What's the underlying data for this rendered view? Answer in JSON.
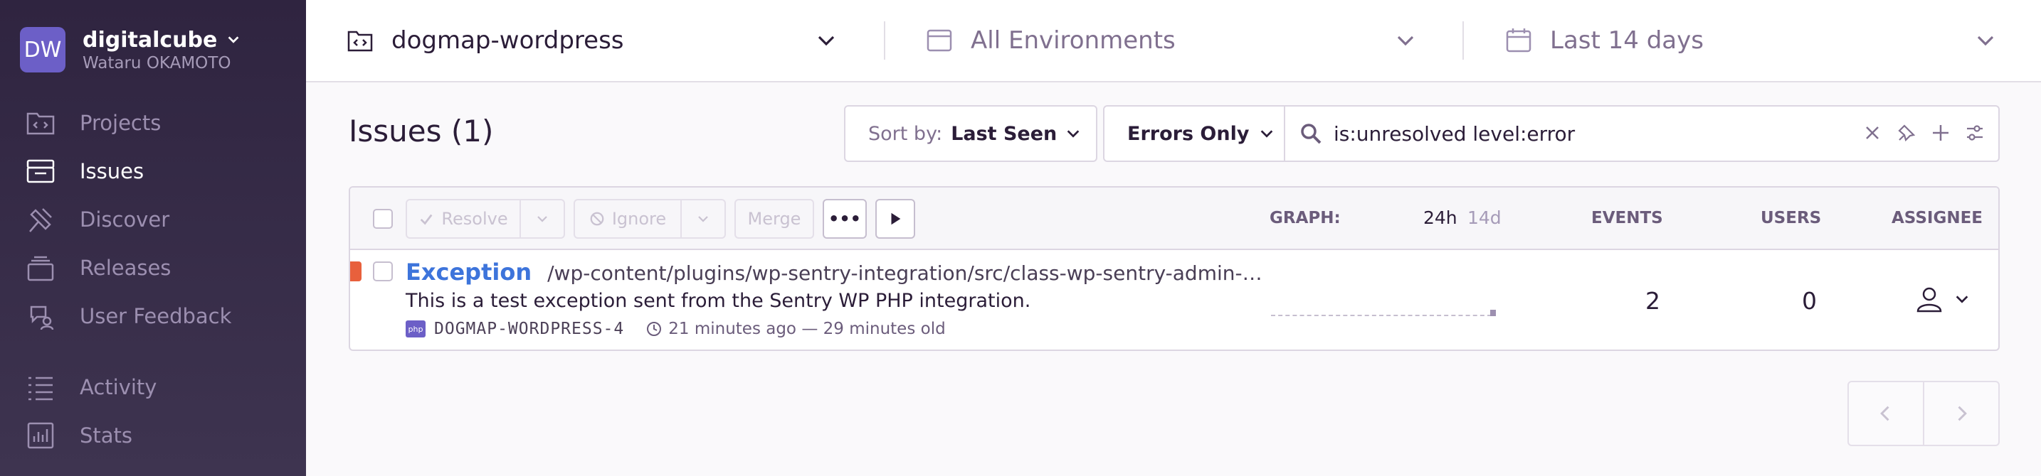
{
  "org": {
    "initials": "DW",
    "name": "digitalcube",
    "user": "Wataru OKAMOTO"
  },
  "sidebar": {
    "items": [
      {
        "label": "Projects",
        "icon": "projects-icon",
        "active": false
      },
      {
        "label": "Issues",
        "icon": "issues-icon",
        "active": true
      },
      {
        "label": "Discover",
        "icon": "discover-icon",
        "active": false
      },
      {
        "label": "Releases",
        "icon": "releases-icon",
        "active": false
      },
      {
        "label": "User Feedback",
        "icon": "user-feedback-icon",
        "active": false
      },
      {
        "label": "Activity",
        "icon": "activity-icon",
        "active": false
      },
      {
        "label": "Stats",
        "icon": "stats-icon",
        "active": false
      }
    ]
  },
  "header": {
    "project": "dogmap-wordpress",
    "environment": "All Environments",
    "period": "Last 14 days"
  },
  "issues": {
    "title": "Issues (1)",
    "sort_label": "Sort by:",
    "sort_value": "Last Seen",
    "filter": "Errors Only",
    "search_value": "is:unresolved level:error"
  },
  "toolbar": {
    "resolve": "Resolve",
    "ignore": "Ignore",
    "merge": "Merge",
    "more": "•••"
  },
  "columns": {
    "graph": "GRAPH:",
    "range_24h": "24h",
    "range_14d": "14d",
    "events": "EVENTS",
    "users": "USERS",
    "assignee": "ASSIGNEE"
  },
  "issue": {
    "type": "Exception",
    "path": "/wp-content/plugins/wp-sentry-integration/src/class-wp-sentry-admin-…",
    "message": "This is a test exception sent from the Sentry WP PHP integration.",
    "platform": "php",
    "short_id": "DOGMAP-WORDPRESS-4",
    "time": "21 minutes ago — 29 minutes old",
    "events": "2",
    "users": "0",
    "level_color": "#e8603c"
  },
  "colors": {
    "accent": "#6c5fc7",
    "link": "#3d74db",
    "sidebar_bg": "#2f2440"
  }
}
